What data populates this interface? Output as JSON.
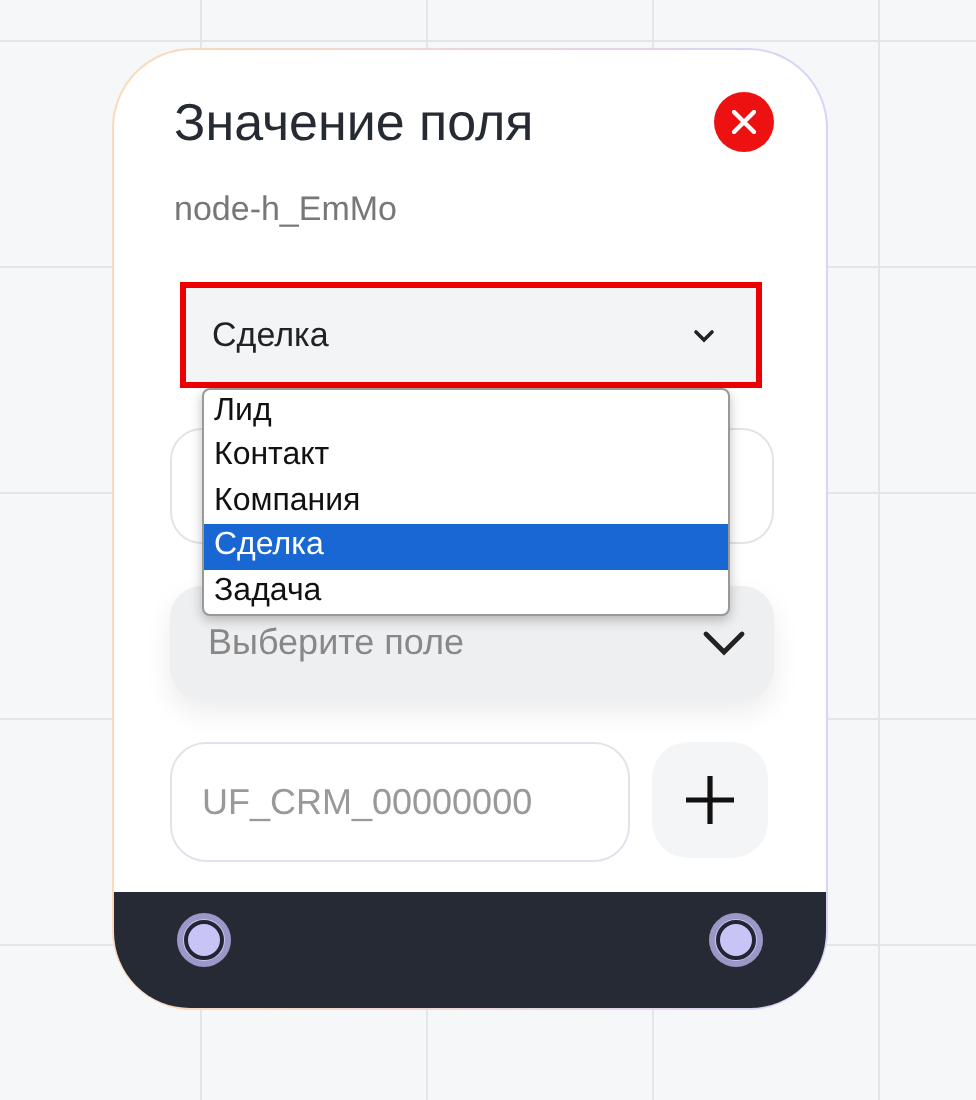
{
  "node": {
    "title": "Значение поля",
    "node_id": "node-h_EmMo",
    "entity_select": {
      "value": "Сделка",
      "expanded": true,
      "options": [
        {
          "label": "Лид",
          "selected": false
        },
        {
          "label": "Контакт",
          "selected": false
        },
        {
          "label": "Компания",
          "selected": false
        },
        {
          "label": "Сделка",
          "selected": true
        },
        {
          "label": "Задача",
          "selected": false
        }
      ]
    },
    "field_select": {
      "placeholder": "Выберите поле"
    },
    "code_input": {
      "placeholder": "UF_CRM_00000000"
    }
  }
}
